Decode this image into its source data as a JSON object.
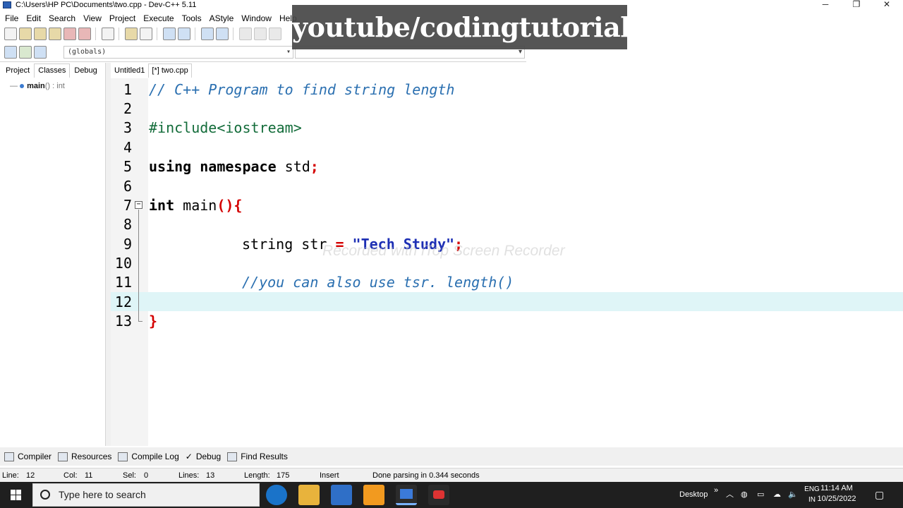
{
  "window": {
    "title": "C:\\Users\\HP PC\\Documents\\two.cpp - Dev-C++ 5.11"
  },
  "menu": [
    "File",
    "Edit",
    "Search",
    "View",
    "Project",
    "Execute",
    "Tools",
    "AStyle",
    "Window",
    "Help"
  ],
  "toolbar": {
    "scope_select": "(globals)",
    "function_select": ""
  },
  "overlay": {
    "banner": "youtube/codingtutorial",
    "recorder_watermark": "Recorded with iTop Screen Recorder"
  },
  "left_panel": {
    "tabs": [
      "Project",
      "Classes",
      "Debug"
    ],
    "active_tab": "Classes",
    "tree_item_name": "main",
    "tree_item_sig": "() : int"
  },
  "file_tabs": [
    "Untitled1",
    "[*] two.cpp"
  ],
  "editor": {
    "line_numbers": [
      "1",
      "2",
      "3",
      "4",
      "5",
      "6",
      "7",
      "8",
      "9",
      "10",
      "11",
      "12",
      "13"
    ],
    "lines": {
      "l1": "// C++ Program to find string length",
      "l3": "#include<iostream>",
      "l5_kw": "using namespace",
      "l5_rest": " std",
      "l5_semi": ";",
      "l7_kw": "int",
      "l7_rest": " main",
      "l7_brace": "(){",
      "l9_a": "string str ",
      "l9_eq": "=",
      "l9_str": " \"Tech Study\"",
      "l9_semi": ";",
      "l11": "//you can also use tsr. length()",
      "l13": "}"
    },
    "current_line": 12
  },
  "bottom_tabs": [
    "Compiler",
    "Resources",
    "Compile Log",
    "Debug",
    "Find Results"
  ],
  "status": {
    "line_label": "Line:",
    "line": "12",
    "col_label": "Col:",
    "col": "11",
    "sel_label": "Sel:",
    "sel": "0",
    "lines_label": "Lines:",
    "lines": "13",
    "length_label": "Length:",
    "length": "175",
    "mode": "Insert",
    "message": "Done parsing in 0.344 seconds"
  },
  "taskbar": {
    "search_placeholder": "Type here to search",
    "desktop_label": "Desktop",
    "lang_top": "ENG",
    "lang_bottom": "IN",
    "time": "11:14 AM",
    "date": "10/25/2022"
  }
}
